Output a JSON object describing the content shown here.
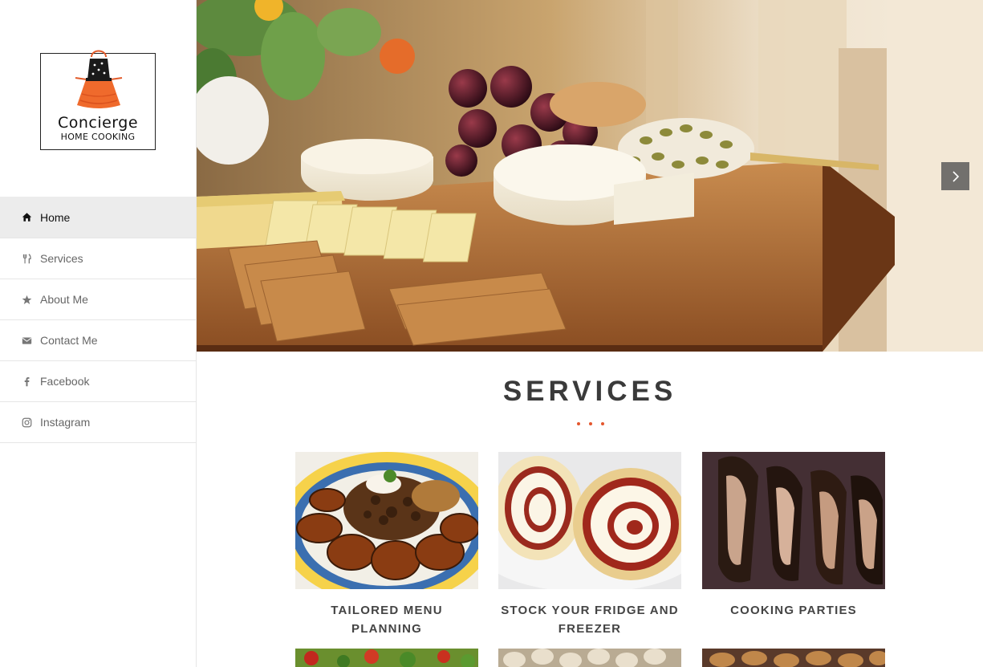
{
  "brand": {
    "logo_name": "Concierge",
    "logo_sub": "HOME COOKING"
  },
  "nav": {
    "items": [
      {
        "label": "Home",
        "icon": "home-icon",
        "active": true
      },
      {
        "label": "Services",
        "icon": "utensils-icon",
        "active": false
      },
      {
        "label": "About Me",
        "icon": "star-icon",
        "active": false
      },
      {
        "label": "Contact Me",
        "icon": "envelope-icon",
        "active": false
      },
      {
        "label": "Facebook",
        "icon": "facebook-icon",
        "active": false
      },
      {
        "label": "Instagram",
        "icon": "instagram-icon",
        "active": false
      }
    ]
  },
  "hero": {
    "next_icon": "chevron-right-icon"
  },
  "services": {
    "title": "SERVICES",
    "accent_color": "#e4572e",
    "cards": [
      {
        "caption": "TAILORED MENU PLANNING"
      },
      {
        "caption": "STOCK YOUR FRIDGE AND FREEZER"
      },
      {
        "caption": "COOKING PARTIES"
      }
    ]
  }
}
